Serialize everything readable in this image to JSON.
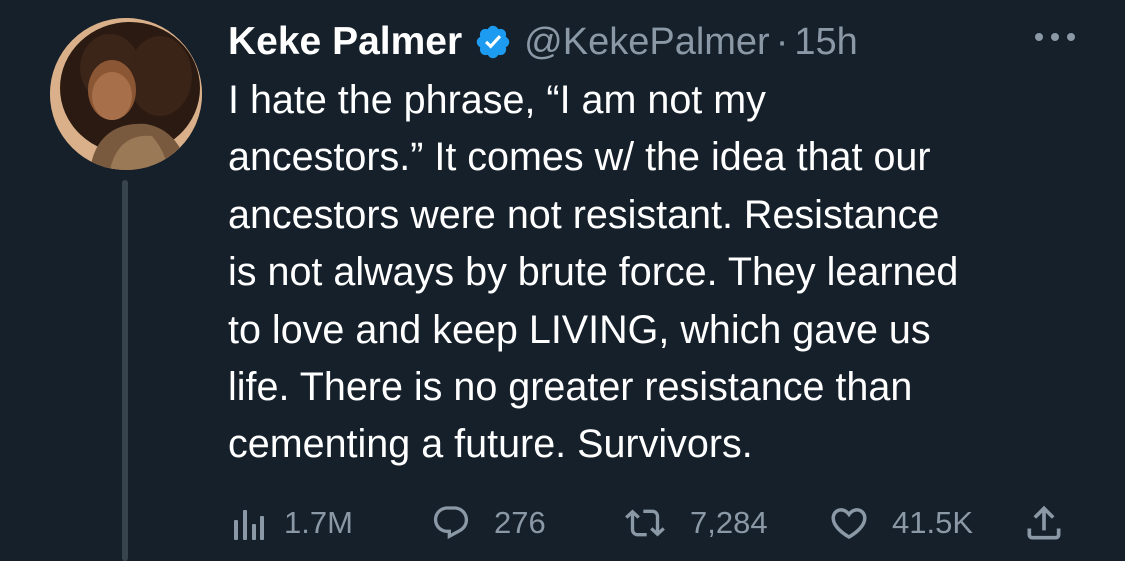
{
  "tweet": {
    "display_name": "Keke Palmer",
    "handle": "@KekePalmer",
    "separator": "·",
    "time": "15h",
    "text": "I hate the phrase, “I am not my\nancestors.” It comes w/ the idea that our\nancestors were not resistant. Resistance\nis not always by brute force. They learned\nto love and keep LIVING, which gave us\nlife. There is no greater resistance than\ncementing a future. Survivors.",
    "icons": {
      "verified": "verified-badge-icon",
      "more": "more-options-icon",
      "views": "analytics-icon",
      "reply": "reply-icon",
      "retweet": "retweet-icon",
      "like": "heart-icon",
      "share": "share-icon"
    },
    "stats": {
      "views": "1.7M",
      "replies": "276",
      "retweets": "7,284",
      "likes": "41.5K"
    }
  },
  "colors": {
    "background": "#15202b",
    "text_primary": "#ffffff",
    "text_secondary": "#8b98a5",
    "verified_blue": "#1d9bf0",
    "thread_line": "#38444d"
  }
}
